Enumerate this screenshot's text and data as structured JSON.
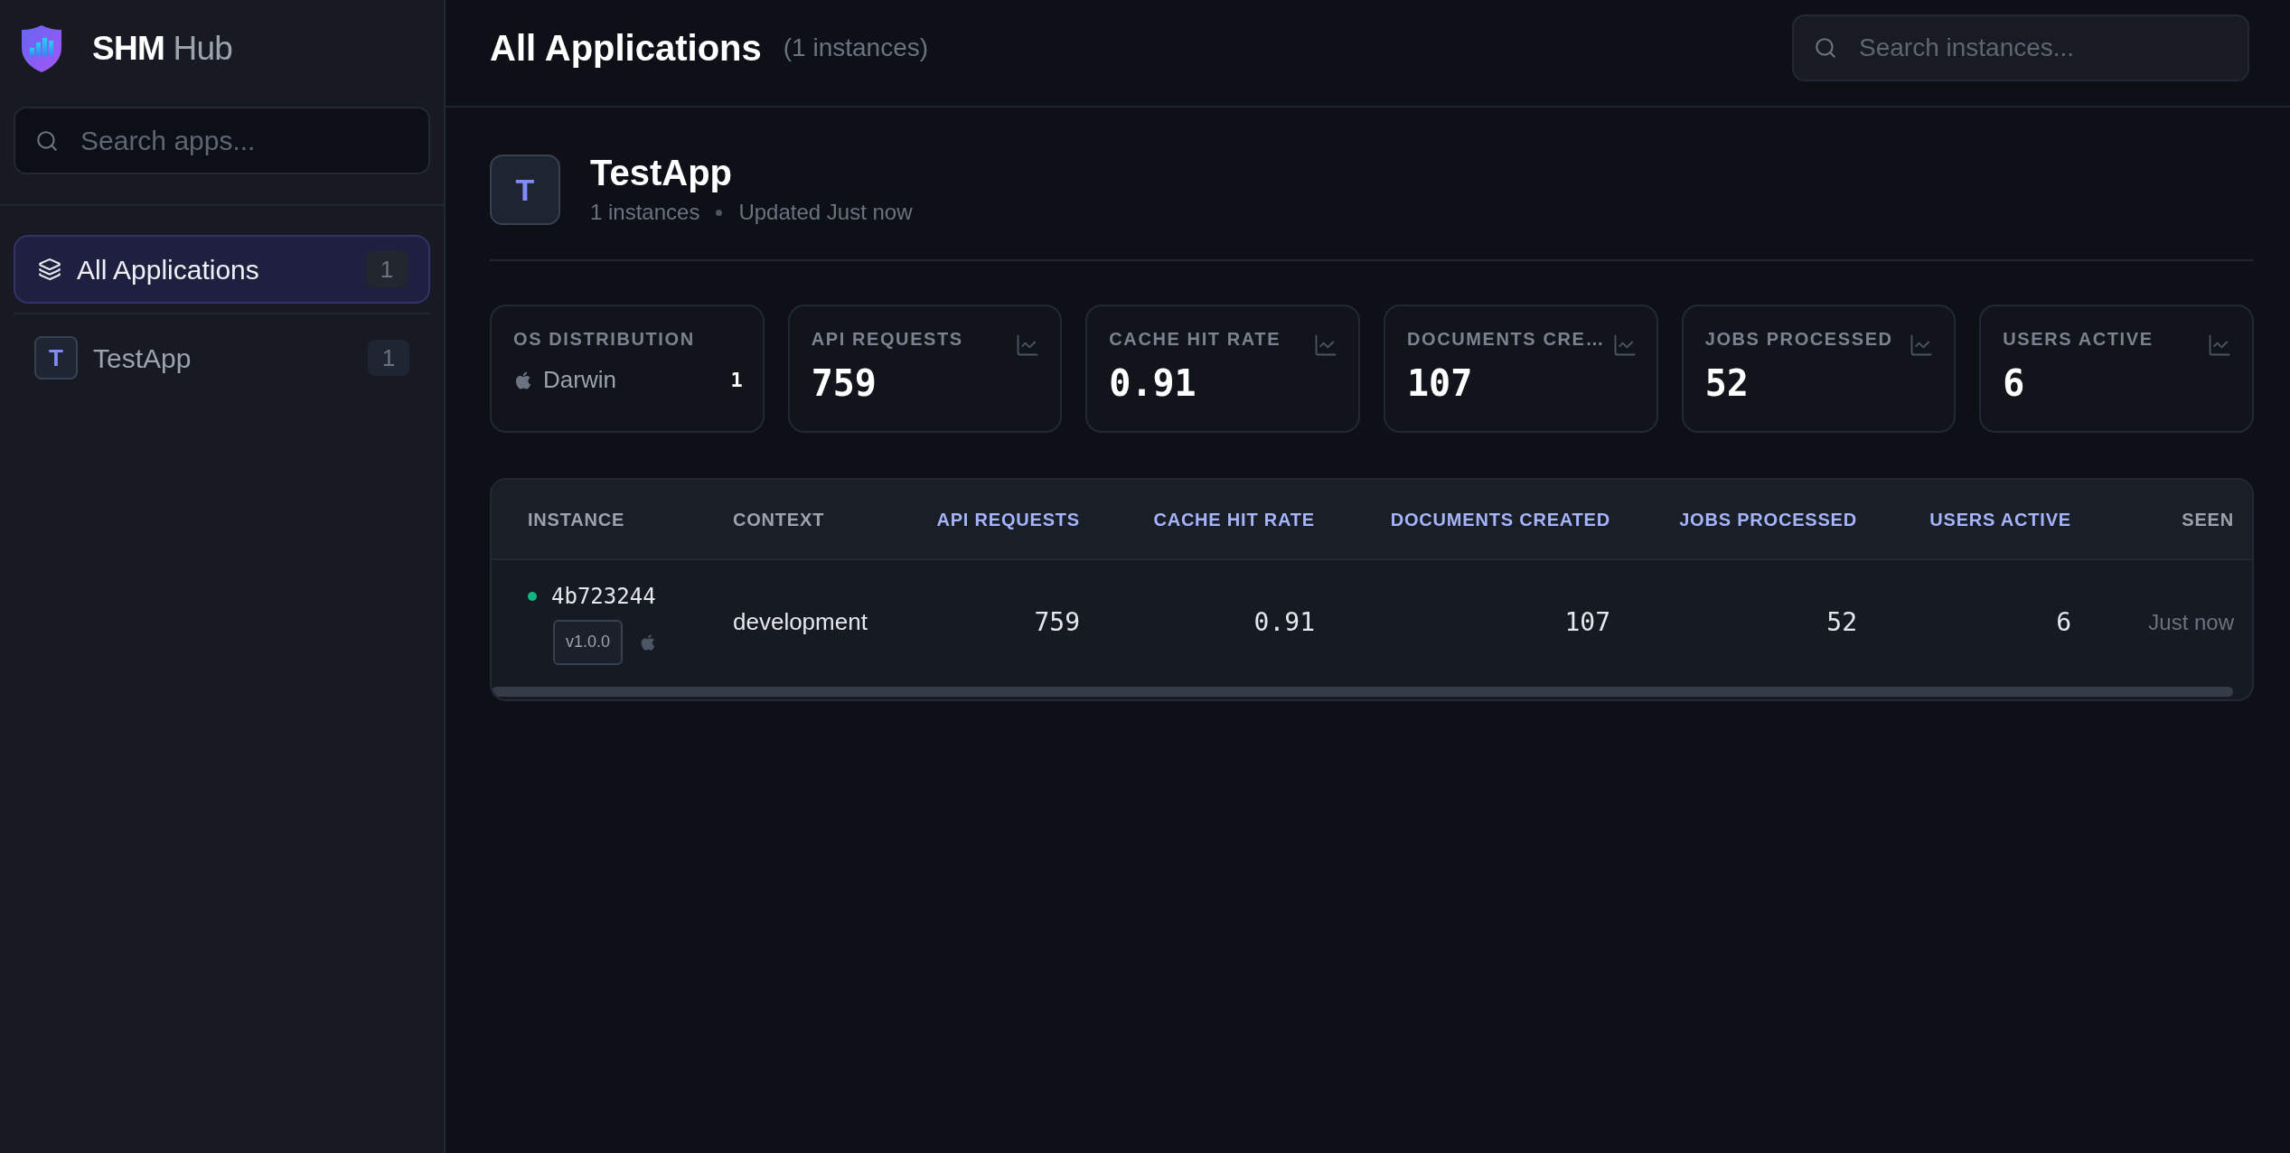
{
  "sidebar": {
    "brand": "**SHM** Hub",
    "search": {
      "placeholder": "Search apps..."
    },
    "items": [
      {
        "kind": "all",
        "label": "All Applications",
        "count": "1",
        "selected": true
      },
      {
        "kind": "app",
        "avatar": "T",
        "label": "TestApp",
        "count": "1",
        "selected": false
      }
    ]
  },
  "header": {
    "title": "All Applications",
    "subtitle": "(1 instances)",
    "search": {
      "placeholder": "Search instances..."
    }
  },
  "app": {
    "avatar": "T",
    "name": "TestApp",
    "instances": "1 instances",
    "updated": "Updated Just now"
  },
  "stats": [
    {
      "kind": "os",
      "label": "OS DISTRIBUTION",
      "entries": [
        {
          "name": "Darwin",
          "count": "1"
        }
      ]
    },
    {
      "kind": "metric",
      "label": "API REQUESTS",
      "value": "759"
    },
    {
      "kind": "metric",
      "label": "CACHE HIT RATE",
      "value": "0.91"
    },
    {
      "kind": "metric",
      "label": "DOCUMENTS CRE…",
      "value": "107"
    },
    {
      "kind": "metric",
      "label": "JOBS PROCESSED",
      "value": "52"
    },
    {
      "kind": "metric",
      "label": "USERS ACTIVE",
      "value": "6"
    }
  ],
  "table": {
    "columns": [
      {
        "kind": "instance",
        "label": "INSTANCE"
      },
      {
        "kind": "text",
        "label": "CONTEXT"
      },
      {
        "kind": "metric",
        "label": "API REQUESTS"
      },
      {
        "kind": "metric",
        "label": "CACHE HIT RATE"
      },
      {
        "kind": "metric",
        "label": "DOCUMENTS CREATED"
      },
      {
        "kind": "metric",
        "label": "JOBS PROCESSED"
      },
      {
        "kind": "metric",
        "label": "USERS ACTIVE"
      },
      {
        "kind": "time",
        "label": "SEEN"
      }
    ],
    "rows": [
      {
        "cells": [
          {
            "text": "4b723244",
            "online": true,
            "version": "v1.0.0"
          },
          {
            "text": "development"
          },
          {
            "text": "759"
          },
          {
            "text": "0.91"
          },
          {
            "text": "107"
          },
          {
            "text": "52"
          },
          {
            "text": "6"
          },
          {
            "text": "Just now"
          }
        ]
      }
    ]
  }
}
